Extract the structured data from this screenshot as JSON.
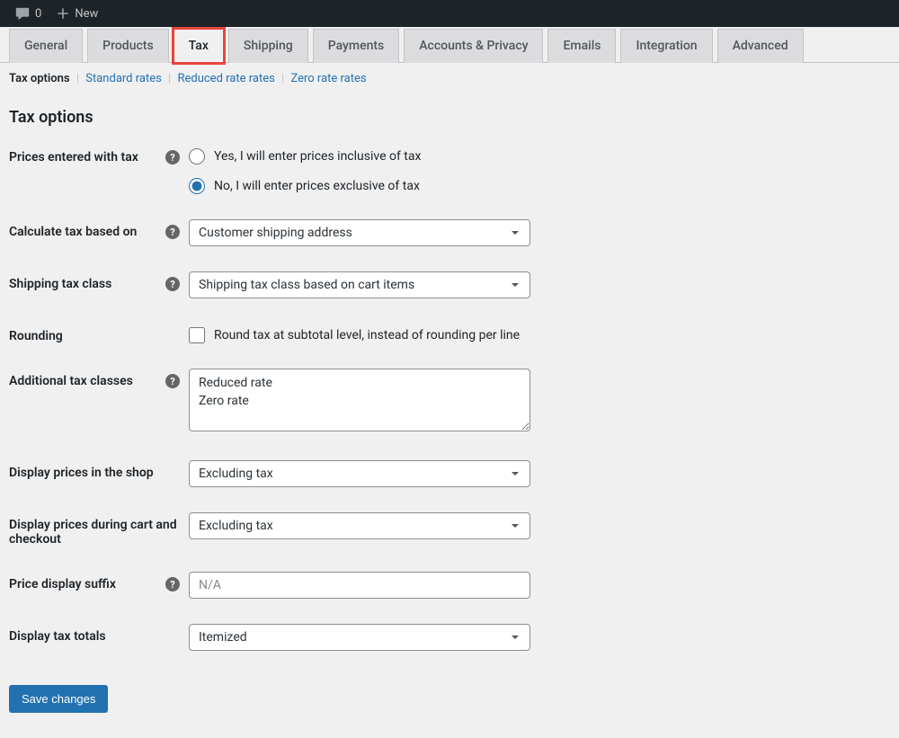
{
  "adminbar": {
    "comments_count": "0",
    "new_label": "New"
  },
  "tabs": [
    {
      "label": "General",
      "active": false
    },
    {
      "label": "Products",
      "active": false
    },
    {
      "label": "Tax",
      "active": true,
      "highlighted": true
    },
    {
      "label": "Shipping",
      "active": false
    },
    {
      "label": "Payments",
      "active": false
    },
    {
      "label": "Accounts & Privacy",
      "active": false
    },
    {
      "label": "Emails",
      "active": false
    },
    {
      "label": "Integration",
      "active": false
    },
    {
      "label": "Advanced",
      "active": false
    }
  ],
  "subtabs": {
    "active": "Tax options",
    "links": [
      "Standard rates",
      "Reduced rate rates",
      "Zero rate rates"
    ]
  },
  "heading": "Tax options",
  "fields": {
    "prices_entered": {
      "label": "Prices entered with tax",
      "option_yes": "Yes, I will enter prices inclusive of tax",
      "option_no": "No, I will enter prices exclusive of tax",
      "selected": "no"
    },
    "calc_based_on": {
      "label": "Calculate tax based on",
      "value": "Customer shipping address"
    },
    "shipping_tax_class": {
      "label": "Shipping tax class",
      "value": "Shipping tax class based on cart items"
    },
    "rounding": {
      "label": "Rounding",
      "option": "Round tax at subtotal level, instead of rounding per line",
      "checked": false
    },
    "additional_classes": {
      "label": "Additional tax classes",
      "value": "Reduced rate\nZero rate"
    },
    "display_shop": {
      "label": "Display prices in the shop",
      "value": "Excluding tax"
    },
    "display_cart": {
      "label": "Display prices during cart and checkout",
      "value": "Excluding tax"
    },
    "price_suffix": {
      "label": "Price display suffix",
      "placeholder": "N/A",
      "value": ""
    },
    "display_totals": {
      "label": "Display tax totals",
      "value": "Itemized"
    }
  },
  "save_button": "Save changes"
}
